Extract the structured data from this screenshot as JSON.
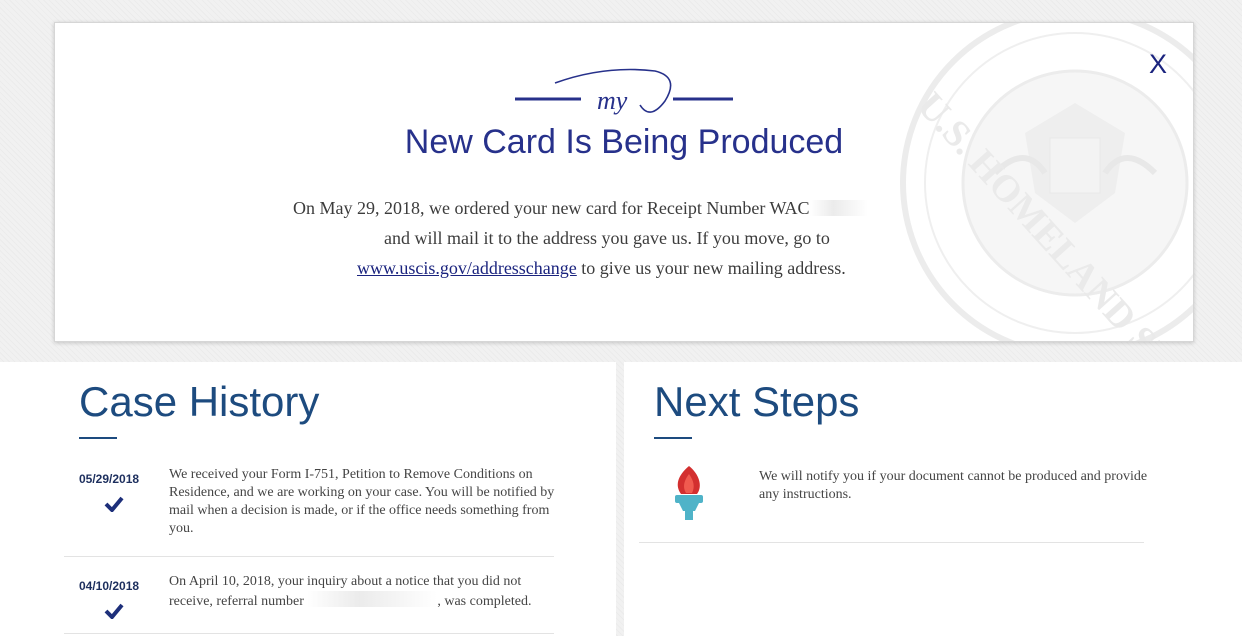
{
  "status_card": {
    "logo_text": "my",
    "title": "New Card Is Being Produced",
    "body": {
      "line1": "On May 29, 2018, we ordered your new card for Receipt Number WAC",
      "line2": "and will mail it to the address you gave us. If you move, go to",
      "link": "www.uscis.gov/addresschange",
      "line3_tail": " to give us your new mailing address."
    },
    "close_label": "X",
    "seal_text": "U.S. HOMELAND SECU"
  },
  "case_history": {
    "title": "Case History",
    "items": [
      {
        "date": "05/29/2018",
        "text": "We received your Form I-751, Petition to Remove Conditions on Residence, and we are working on your case. You will be notified by mail when a decision is made, or if the office needs something from you."
      },
      {
        "date": "04/10/2018",
        "text_before": "On April 10, 2018, your inquiry about a notice that you did not receive, referral number ",
        "text_after": ", was completed."
      }
    ]
  },
  "next_steps": {
    "title": "Next Steps",
    "items": [
      {
        "icon": "torch-icon",
        "text": "We will notify you if your document cannot be produced and provide any instructions."
      }
    ]
  },
  "colors": {
    "accent": "#1a237e",
    "heading": "#1d4b7f",
    "torch_flame": "#d32f2f",
    "torch_base": "#4fb3c8"
  }
}
